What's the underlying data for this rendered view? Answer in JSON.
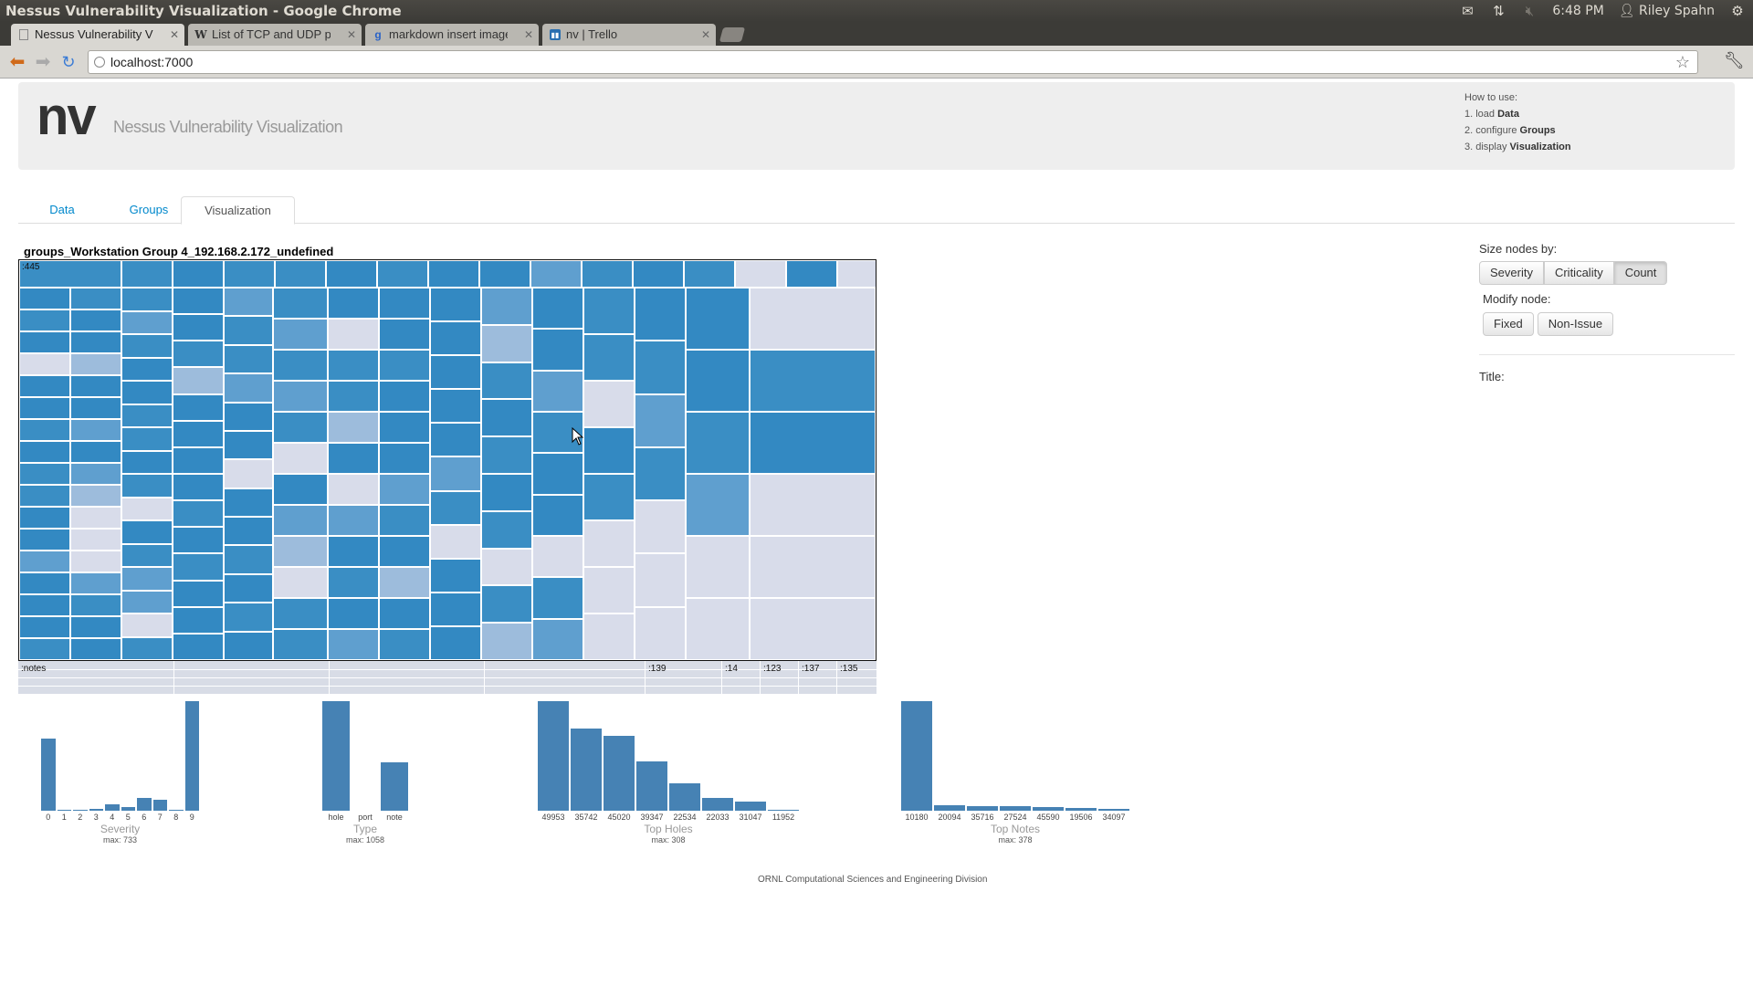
{
  "window": {
    "title": "Nessus Vulnerability Visualization - Google Chrome",
    "clock": "6:48 PM",
    "user": "Riley Spahn"
  },
  "browser": {
    "tabs": [
      {
        "label": "Nessus Vulnerability Visua",
        "icon": "page-icon"
      },
      {
        "label": "List of TCP and UDP port n",
        "icon": "wikipedia-icon"
      },
      {
        "label": "markdown insert image - G",
        "icon": "google-icon"
      },
      {
        "label": "nv | Trello",
        "icon": "trello-icon"
      }
    ],
    "url": "localhost:7000"
  },
  "app": {
    "brand": "nv",
    "subtitle": "Nessus Vulnerability Visualization",
    "howto": {
      "heading": "How to use:",
      "steps": [
        {
          "num": "1. load ",
          "bold": "Data"
        },
        {
          "num": "2. configure ",
          "bold": "Groups"
        },
        {
          "num": "3. display ",
          "bold": "Visualization"
        }
      ]
    },
    "nav_tabs": [
      "Data",
      "Groups",
      "Visualization"
    ],
    "active_tab": "Visualization"
  },
  "visualization": {
    "title": "groups_Workstation Group 4_192.168.2.172_undefined",
    "treemap_label": ":445",
    "notes_strip": {
      "label": ":notes",
      "cells": [
        ":139",
        ":14",
        ":123",
        ":137",
        ":135"
      ]
    }
  },
  "side_panel": {
    "size_label": "Size nodes by:",
    "size_options": [
      "Severity",
      "Criticality",
      "Count"
    ],
    "size_active": "Count",
    "modify_label": "Modify node:",
    "modify_options": [
      "Fixed",
      "Non-Issue"
    ],
    "title_label": "Title:"
  },
  "chart_data": [
    {
      "type": "bar",
      "title": "Severity",
      "categories": [
        "0",
        "1",
        "2",
        "3",
        "4",
        "5",
        "6",
        "7",
        "8",
        "9"
      ],
      "values": [
        480,
        4,
        4,
        12,
        40,
        25,
        85,
        75,
        8,
        733
      ],
      "max_label": "max: 733"
    },
    {
      "type": "bar",
      "title": "Type",
      "categories": [
        "hole",
        "port",
        "note"
      ],
      "values": [
        1058,
        0,
        470
      ],
      "max_label": "max: 1058"
    },
    {
      "type": "bar",
      "title": "Top Holes",
      "categories": [
        "49953",
        "35742",
        "45020",
        "39347",
        "22534",
        "22033",
        "31047",
        "11952"
      ],
      "values": [
        308,
        232,
        210,
        138,
        78,
        35,
        26,
        3
      ],
      "max_label": "max: 308"
    },
    {
      "type": "bar",
      "title": "Top Notes",
      "categories": [
        "10180",
        "20094",
        "35716",
        "27524",
        "45590",
        "19506",
        "34097"
      ],
      "values": [
        378,
        20,
        17,
        16,
        14,
        10,
        5
      ],
      "max_label": "max: 378"
    }
  ],
  "footer": "ORNL Computational Sciences and Engineering Division"
}
